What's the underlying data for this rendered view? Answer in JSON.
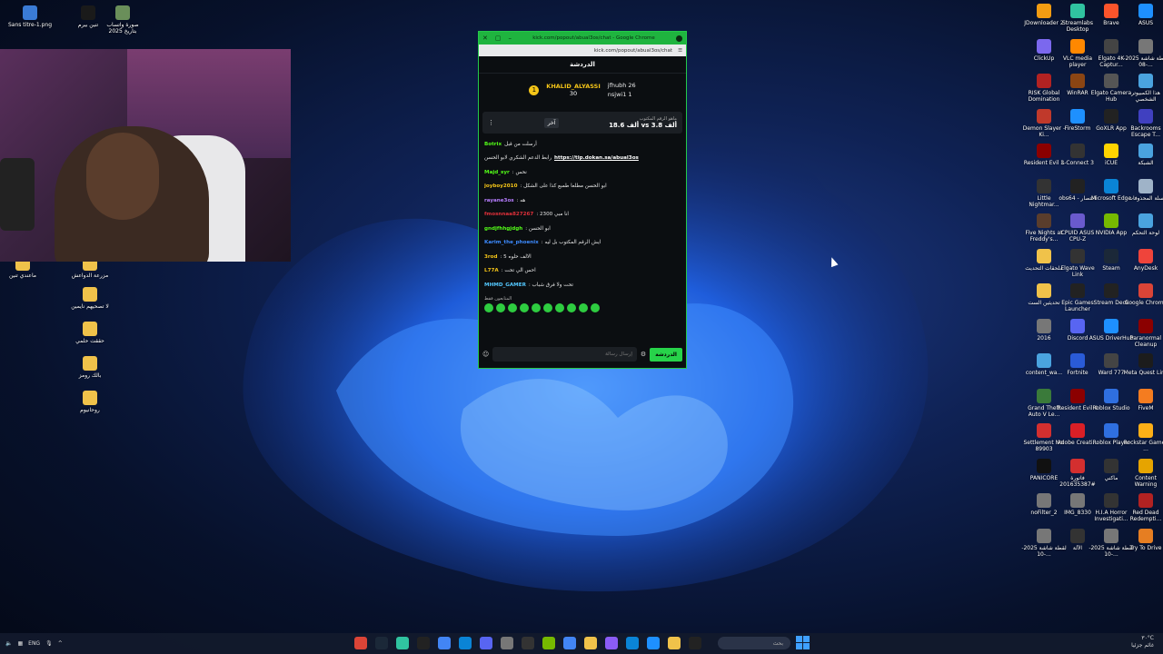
{
  "left_desktop_icons": [
    {
      "label": "Sans titre-1.png",
      "color": "#3a7bd5"
    },
    {
      "label": "تنين بيرم",
      "color": "#1a1a1a"
    },
    {
      "label": "صورة واتساب بتاريخ 2025",
      "color": "#6a8f5a"
    },
    {
      "label": "ماعندي تنين",
      "color": "#f0c24a"
    },
    {
      "label": "مزرعة الدواعش",
      "color": "#f0c24a"
    },
    {
      "label": "لا تصحيهم نايمين",
      "color": "#f0c24a"
    },
    {
      "label": "حققت حلمي",
      "color": "#f0c24a"
    },
    {
      "label": "بالك رومز",
      "color": "#f0c24a"
    },
    {
      "label": "روحانيوم",
      "color": "#f0c24a"
    }
  ],
  "right_desktop_icons": [
    {
      "label": "JDownloader 2",
      "color": "#f39c12"
    },
    {
      "label": "Streamlabs Desktop",
      "color": "#30c3a0"
    },
    {
      "label": "Brave",
      "color": "#fb542b"
    },
    {
      "label": "ASUS",
      "color": "#1e90ff"
    },
    {
      "label": "ClickUp",
      "color": "#7b68ee"
    },
    {
      "label": "VLC media player",
      "color": "#ff8800"
    },
    {
      "label": "Elgato 4K Captur...",
      "color": "#444"
    },
    {
      "label": "لقطة شاشة 2025-08-...",
      "color": "#777"
    },
    {
      "label": "RISK Global Domination",
      "color": "#b22222"
    },
    {
      "label": "WinRAR",
      "color": "#8b4513"
    },
    {
      "label": "Elgato Camera Hub",
      "color": "#555"
    },
    {
      "label": "هذا الكمبيوتر الشخصي",
      "color": "#4aa3df"
    },
    {
      "label": "Demon Slayer -Ki...",
      "color": "#c0392b"
    },
    {
      "label": "FireStorm",
      "color": "#1e90ff"
    },
    {
      "label": "GoXLR App",
      "color": "#222"
    },
    {
      "label": "Backrooms Escape T...",
      "color": "#4040c0"
    },
    {
      "label": "Resident Evil 3",
      "color": "#8b0000"
    },
    {
      "label": "L-Connect 3",
      "color": "#333"
    },
    {
      "label": "iCUE",
      "color": "#ffd400"
    },
    {
      "label": "الشبكة",
      "color": "#4aa3df"
    },
    {
      "label": "Little Nightmar...",
      "color": "#333"
    },
    {
      "label": "obs64 - اختصار",
      "color": "#222"
    },
    {
      "label": "Microsoft Edge",
      "color": "#0a84d6"
    },
    {
      "label": "سلة المحذوفات",
      "color": "#9fb3c8"
    },
    {
      "label": "Five Nights at Freddy's...",
      "color": "#5a3d2c"
    },
    {
      "label": "CPUID ASUS CPU-Z",
      "color": "#6a5acd"
    },
    {
      "label": "NVIDIA App",
      "color": "#76b900"
    },
    {
      "label": "لوحة التحكم",
      "color": "#4aa3df"
    },
    {
      "label": "ملحقات التحديث",
      "color": "#f0c24a"
    },
    {
      "label": "Elgato Wave Link",
      "color": "#333"
    },
    {
      "label": "Steam",
      "color": "#1b2838"
    },
    {
      "label": "AnyDesk",
      "color": "#ef443b"
    },
    {
      "label": "تحديثين الست",
      "color": "#f0c24a"
    },
    {
      "label": "Epic Games Launcher",
      "color": "#222"
    },
    {
      "label": "Stream Deck",
      "color": "#222"
    },
    {
      "label": "Google Chrome",
      "color": "#db4437"
    },
    {
      "label": "2016",
      "color": "#777"
    },
    {
      "label": "Discord",
      "color": "#5865f2"
    },
    {
      "label": "ASUS DriverHub",
      "color": "#1e90ff"
    },
    {
      "label": "Paranormal Cleanup",
      "color": "#8b0000"
    },
    {
      "label": "content_wa...",
      "color": "#4aa3df"
    },
    {
      "label": "Fortnite",
      "color": "#2a5bd7"
    },
    {
      "label": "Ward 777",
      "color": "#444"
    },
    {
      "label": "Meta Quest Link",
      "color": "#1c1c1c"
    },
    {
      "label": "Grand Theft Auto V Le...",
      "color": "#3a7a3a"
    },
    {
      "label": "Resident Evil 4",
      "color": "#8b0000"
    },
    {
      "label": "Roblox Studio",
      "color": "#2f6fe0"
    },
    {
      "label": "FiveM",
      "color": "#f47c20"
    },
    {
      "label": "Settlement No. 89903",
      "color": "#d32f2f"
    },
    {
      "label": "Adobe Creati...",
      "color": "#da1f26"
    },
    {
      "label": "Roblox Player",
      "color": "#2f6fe0"
    },
    {
      "label": "Rockstar Games ...",
      "color": "#fcaf17"
    },
    {
      "label": "PANICORE",
      "color": "#111"
    },
    {
      "label": "فاتورة #201635387",
      "color": "#d32f2f"
    },
    {
      "label": "ماكني",
      "color": "#333"
    },
    {
      "label": "Content Warning",
      "color": "#e6a400"
    },
    {
      "label": "noFilter_2",
      "color": "#777"
    },
    {
      "label": "IMG_8330",
      "color": "#777"
    },
    {
      "label": "H.I.A Horror Investigati...",
      "color": "#333"
    },
    {
      "label": "Red Dead Redempti...",
      "color": "#b22222"
    },
    {
      "label": "لقطة شاشة 2025-10-...",
      "color": "#777"
    },
    {
      "label": "الآلة",
      "color": "#333"
    },
    {
      "label": "لقطة شاشة 2025-10-...",
      "color": "#777"
    },
    {
      "label": "Try To Drive",
      "color": "#e67e22"
    }
  ],
  "chrome": {
    "title": "kick.com/popout/abual3os/chat - Google Chrome",
    "url": "kick.com/popout/abual3os/chat"
  },
  "chat": {
    "header": "الدردشة",
    "leader_main": "KHALID_ALYASSI",
    "leader_main_count": "30",
    "leader_rank": "1",
    "leader_others": [
      "jfhubh 26",
      "nsjwi1 1"
    ],
    "pinned_label": "ماهو الرقم المكتوب",
    "pinned_values": "18.6 ألف  vs  3.8 ألف",
    "pinned_button": "آخر",
    "messages": [
      {
        "user": "Botrix",
        "text": "أرسلت من قبل",
        "color": "#53fc18"
      },
      {
        "user": "",
        "text": "رابط الدعم الشكري لابو الحسن",
        "link": "https://tip.dokan.sa/abual3os",
        "color": "#ffffff"
      },
      {
        "user": "Majd_syr",
        "text": ": نحس",
        "color": "#53fc18"
      },
      {
        "user": "joyboy2010",
        "text": ": ابو الحسن مطلعا طمبع كذا على الشكل",
        "color": "#f5c518"
      },
      {
        "user": "rayane3os",
        "text": ": هه",
        "color": "#b77dff"
      },
      {
        "user": "fmosnnaa827267",
        "text": ": 2300 انا مبي",
        "color": "#e0303a"
      },
      {
        "user": "gndjfhhgjdgh",
        "text": ": ابو الحسن",
        "color": "#53fc18"
      },
      {
        "user": "Karim_the_phoenix",
        "text": ": ايش الرقم المكتوب بل ليه",
        "color": "#3d8bff"
      },
      {
        "user": "3rod",
        "text": ": الالف حلوه 5",
        "color": "#f5c518"
      },
      {
        "user": "L77A",
        "text": ": احس الي تحت",
        "color": "#f5c518"
      },
      {
        "user": "MHMD_GAMER",
        "text": ": تحت ولا فرق شباب",
        "color": "#53c8ff"
      }
    ],
    "emote_section": "المتابعون فقط",
    "input_placeholder": "إرسال رسالة",
    "send_label": "الدردشة"
  },
  "taskbar": {
    "lang": "ENG",
    "search": "بحث",
    "clock_time": "٣٠°C",
    "clock_date": "غائم جزئيا",
    "apps": [
      "#db4437",
      "#1b2838",
      "#30c3a0",
      "#222",
      "#4285f4",
      "#0a84d6",
      "#5865f2",
      "#777",
      "#333",
      "#76b900",
      "#4285f4",
      "#f0c24a",
      "#8b5cf6",
      "#0a84d6",
      "#1e90ff",
      "#f0c24a",
      "#222"
    ]
  }
}
